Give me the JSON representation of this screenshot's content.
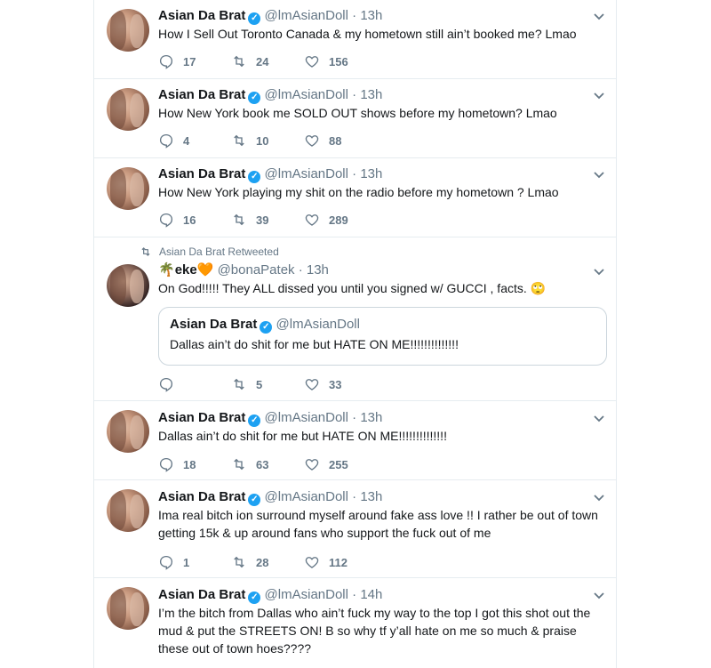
{
  "tweets": [
    {
      "name": "Asian Da Brat",
      "handle": "@lmAsianDoll",
      "time": "13h",
      "text": "How I Sell Out Toronto Canada & my hometown still ain’t booked me? Lmao",
      "replies": "17",
      "retweets": "24",
      "likes": "156"
    },
    {
      "name": "Asian Da Brat",
      "handle": "@lmAsianDoll",
      "time": "13h",
      "text": "How New York book me SOLD OUT shows before my hometown? Lmao",
      "replies": "4",
      "retweets": "10",
      "likes": "88"
    },
    {
      "name": "Asian Da Brat",
      "handle": "@lmAsianDoll",
      "time": "13h",
      "text": "How New York playing my shit on the radio before my hometown ? Lmao",
      "replies": "16",
      "retweets": "39",
      "likes": "289"
    },
    {
      "retweet_label": "Asian Da Brat Retweeted",
      "name_prefix_emoji": "🌴",
      "name": "eke",
      "name_suffix_emoji": "🧡",
      "handle": "@bonaPatek",
      "time": "13h",
      "text": "On God!!!!! They ALL dissed you until you signed w/ GUCCI , facts.",
      "text_emoji": "🙄",
      "quote": {
        "name": "Asian Da Brat",
        "handle": "@lmAsianDoll",
        "text": "Dallas ain’t do shit for me but HATE ON ME!!!!!!!!!!!!!!"
      },
      "replies": "",
      "retweets": "5",
      "likes": "33"
    },
    {
      "name": "Asian Da Brat",
      "handle": "@lmAsianDoll",
      "time": "13h",
      "text": "Dallas ain’t do shit for me but HATE ON ME!!!!!!!!!!!!!!",
      "replies": "18",
      "retweets": "63",
      "likes": "255"
    },
    {
      "name": "Asian Da Brat",
      "handle": "@lmAsianDoll",
      "time": "13h",
      "text": "Ima real bitch ion surround myself around fake ass love !! I rather be out of town getting 15k & up around fans who support the fuck out of me",
      "replies": "1",
      "retweets": "28",
      "likes": "112"
    },
    {
      "name": "Asian Da Brat",
      "handle": "@lmAsianDoll",
      "time": "14h",
      "text": "I’m the bitch from Dallas who ain’t fuck my way to the top I got this shot out the mud & put the STREETS ON! B so why tf y’all hate on me so much & praise these out of town hoes????"
    }
  ],
  "separator": "·",
  "icons": {
    "reply": "reply-icon",
    "retweet": "retweet-icon",
    "like": "heart-icon",
    "verified": "verified-icon",
    "more": "chevron-down-icon"
  },
  "colors": {
    "accent": "#1da1f2",
    "secondary_text": "#657786",
    "border": "#e6ecf0"
  }
}
